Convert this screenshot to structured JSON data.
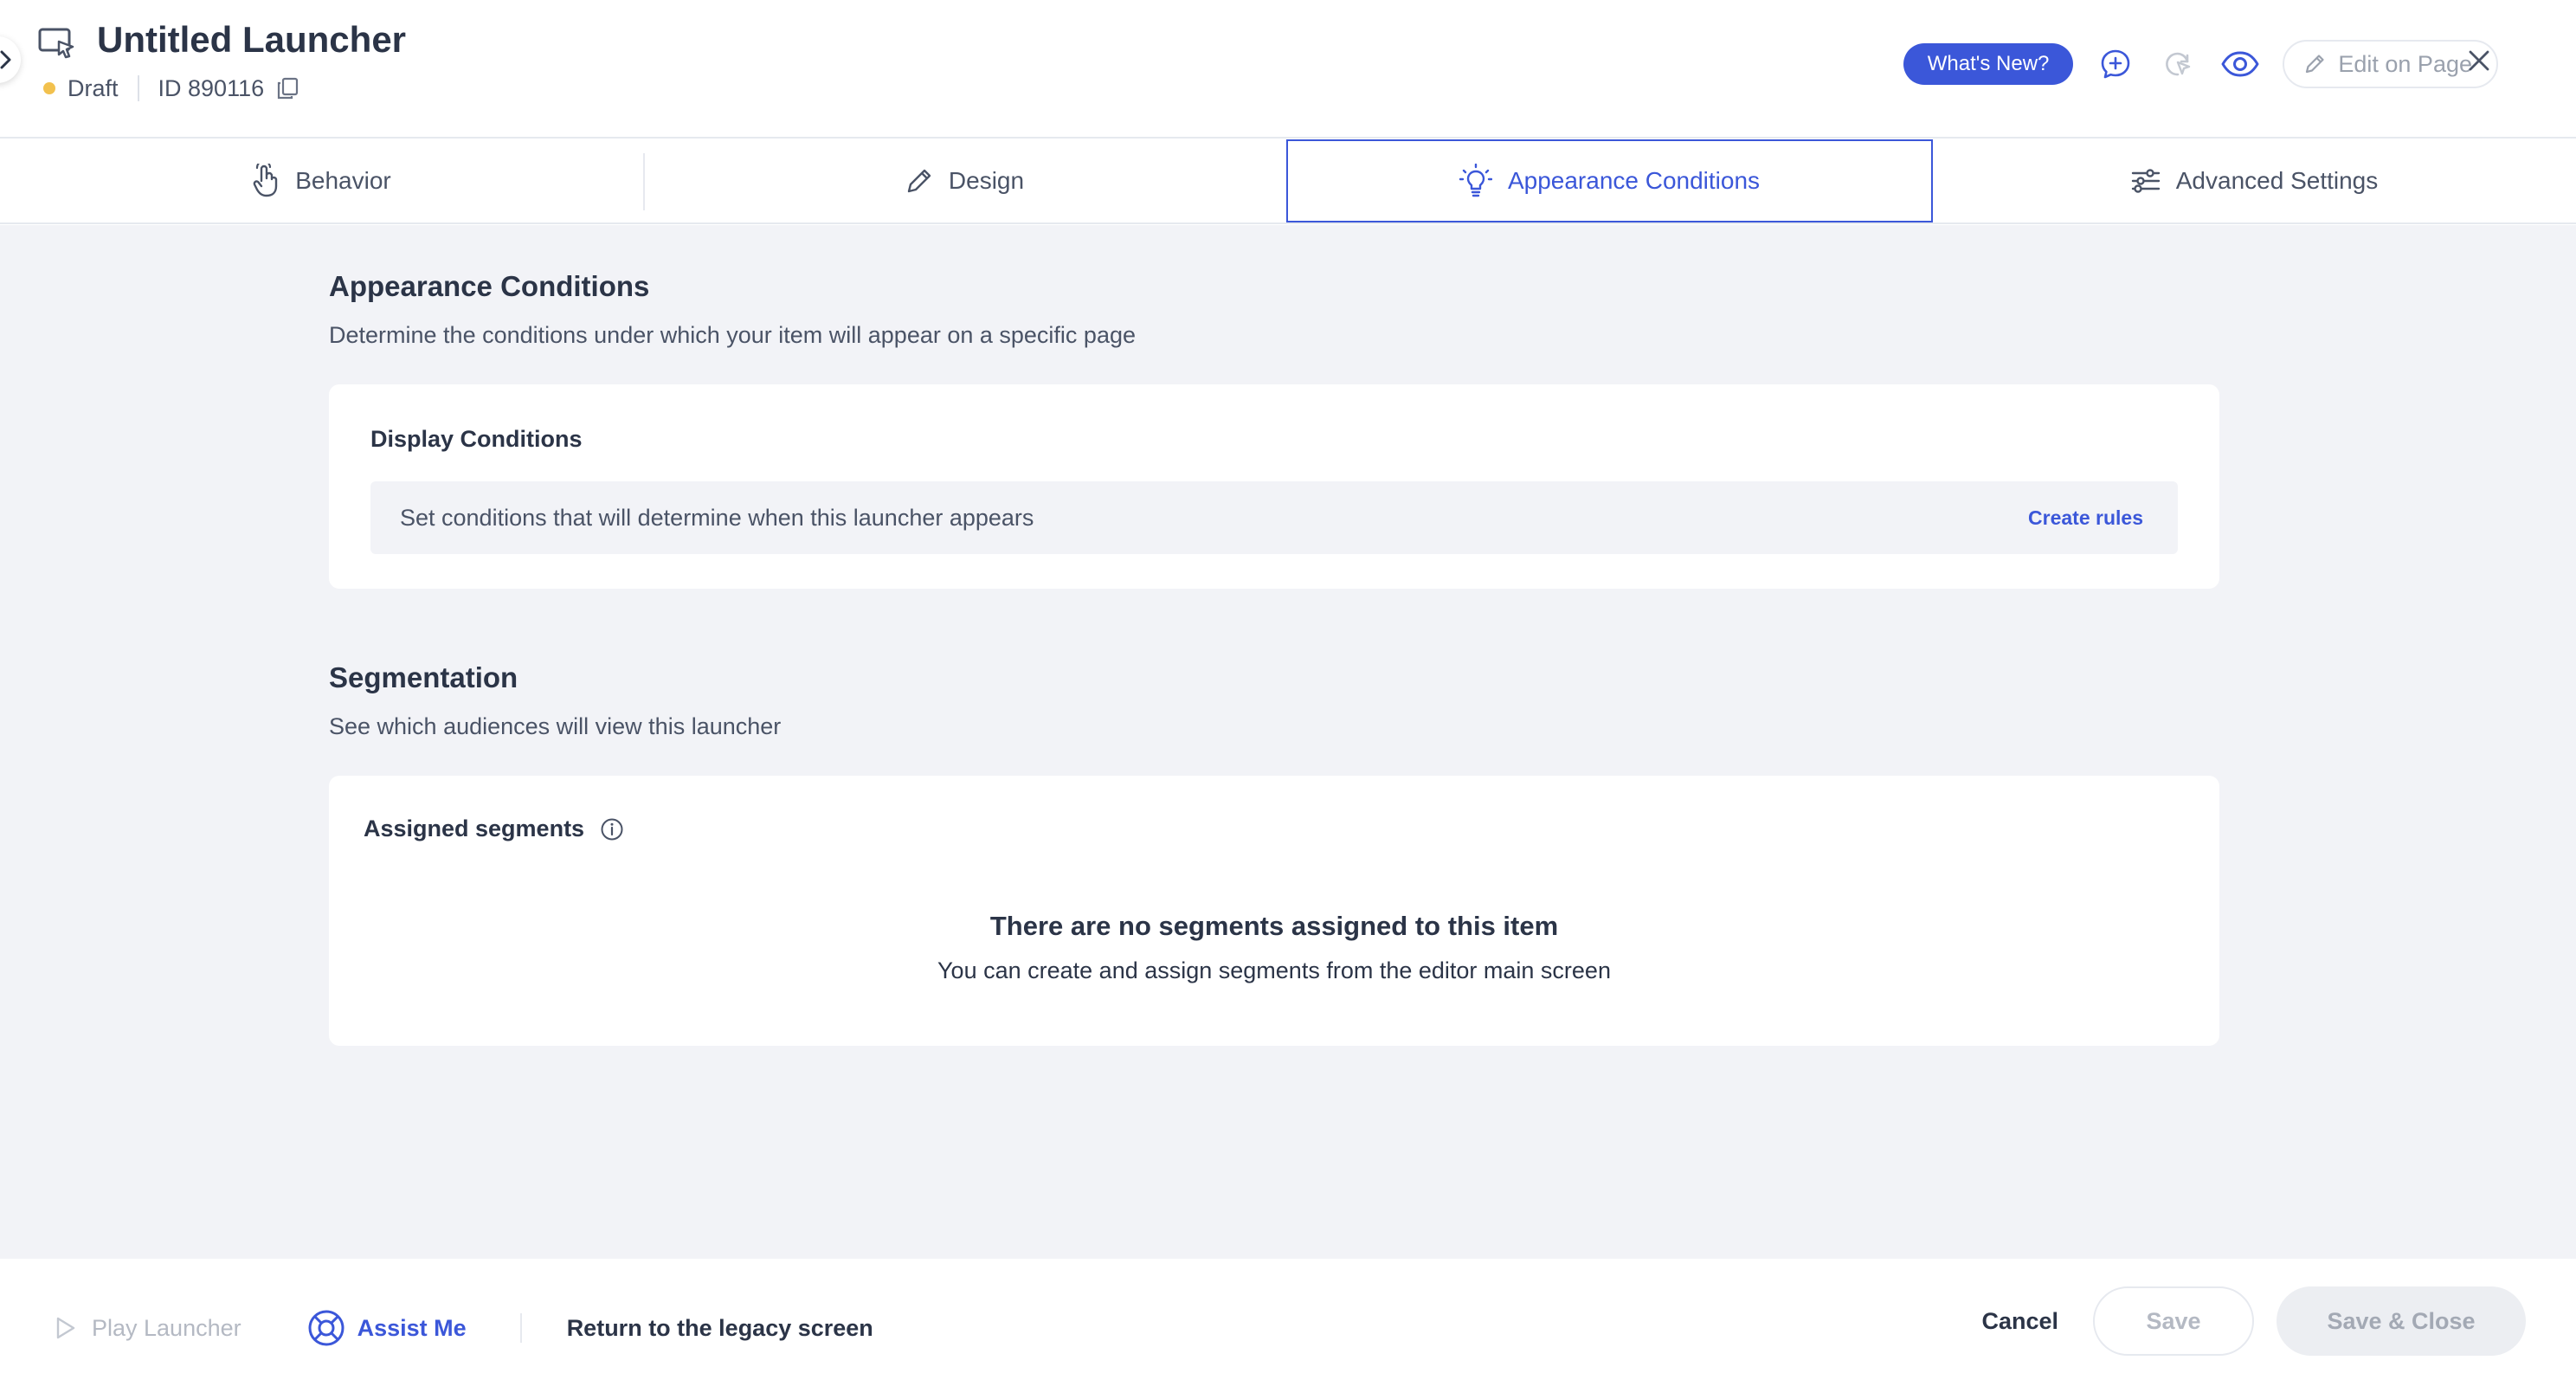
{
  "header": {
    "title": "Untitled Launcher",
    "status": "Draft",
    "id_label": "ID 890116",
    "whats_new": "What's New?",
    "edit_on_page": "Edit on Page"
  },
  "tabs": [
    {
      "label": "Behavior",
      "icon": "hand-pointer-icon",
      "active": false
    },
    {
      "label": "Design",
      "icon": "pencil-icon",
      "active": false
    },
    {
      "label": "Appearance Conditions",
      "icon": "lightbulb-icon",
      "active": true
    },
    {
      "label": "Advanced Settings",
      "icon": "sliders-icon",
      "active": false
    }
  ],
  "appearance": {
    "title": "Appearance Conditions",
    "subtitle": "Determine the conditions under which your item will appear on a specific page",
    "display_conditions": {
      "title": "Display Conditions",
      "text": "Set conditions that will determine when this launcher appears",
      "action": "Create rules"
    }
  },
  "segmentation": {
    "title": "Segmentation",
    "subtitle": "See which audiences will view this launcher",
    "assigned_title": "Assigned segments",
    "empty_title": "There are no segments assigned to this item",
    "empty_sub": "You can create and assign segments from the editor main screen"
  },
  "footer": {
    "play_launcher": "Play Launcher",
    "assist_me": "Assist Me",
    "legacy": "Return to the legacy screen",
    "cancel": "Cancel",
    "save": "Save",
    "save_close": "Save & Close"
  },
  "colors": {
    "accent": "#3b57d9",
    "draft_dot": "#f2c14e",
    "background": "#f2f3f7"
  }
}
